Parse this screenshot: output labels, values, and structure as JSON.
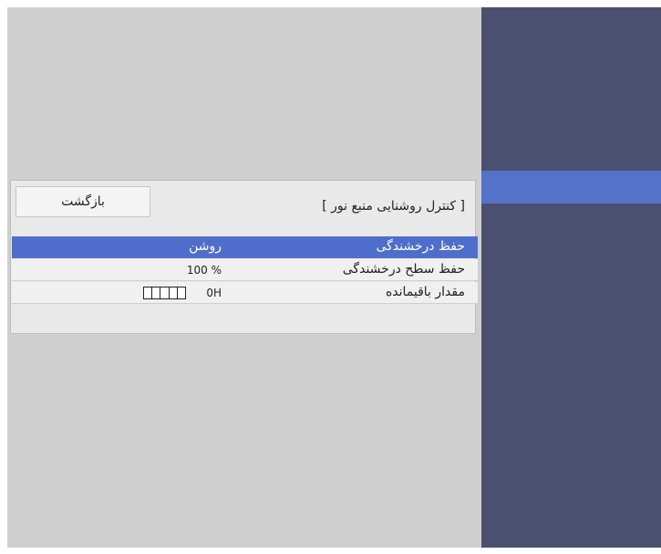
{
  "menu": {
    "back_label": "بازگشت",
    "title": "[ کنترل روشنایی منبع نور ]",
    "rows": [
      {
        "label": "حفظ درخشندگی",
        "value": "روشن",
        "selected": true
      },
      {
        "label": "حفظ سطح درخشندگی",
        "value": "100 %"
      },
      {
        "label": "مقدار باقیمانده",
        "value": "0H",
        "indicator": "battery-level-icon"
      }
    ]
  },
  "colors": {
    "screen_bg": "#cfcfcf",
    "right_panel": "#4c5070",
    "highlight": "#4f6ecb",
    "submenu_bg": "#e9e9e9"
  }
}
